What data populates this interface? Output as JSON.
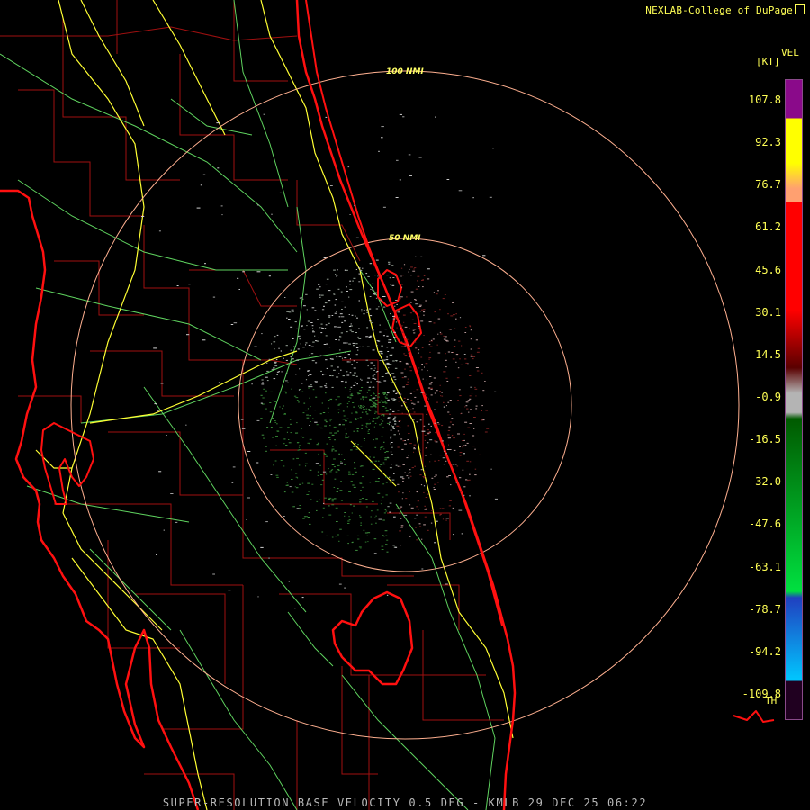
{
  "credit": "NEXLAB-College of DuPage",
  "legend": {
    "product": "VEL",
    "units": "[KT]",
    "ticks": [
      "107.8",
      "92.3",
      "76.7",
      "61.2",
      "45.6",
      "30.1",
      "14.5",
      "-0.9",
      "-16.5",
      "-32.0",
      "-47.6",
      "-63.1",
      "-78.7",
      "-94.2",
      "-109.8"
    ],
    "th_label": "TH",
    "colors": {
      "purple": "#8a0a8a",
      "yellow": "#ffff00",
      "orange": "#ffa070",
      "red": "#ff0000",
      "dark_red": "#5a0000",
      "gray": "#b4b4b4",
      "dark_green": "#005a00",
      "green": "#00e040",
      "blue": "#2040c0",
      "light_blue": "#00c8ff"
    }
  },
  "rings": {
    "outer_label": "100 NMI",
    "inner_label": "50 NMI"
  },
  "footer": "SUPER-RESOLUTION BASE VELOCITY 0.5 DEG - KMLB 29 DEC 25 06:22",
  "map_colors": {
    "background": "#000000",
    "coastline": "#ff1010",
    "county_lines": "#a01010",
    "highways": "#ffff33",
    "roads": "#5fd35f",
    "range_rings": "#ffb090"
  }
}
